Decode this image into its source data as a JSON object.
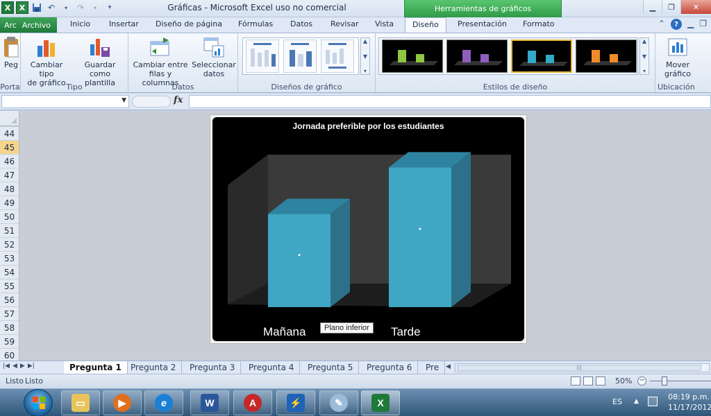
{
  "window": {
    "title": "Gráficas  -  Microsoft Excel uso no comercial",
    "contextual_tab": "Herramientas de gráficos",
    "app_icon_letter": "X"
  },
  "ribbon_tabs": {
    "file": "Archivo",
    "file_left_fragment": "Arc",
    "items": [
      "Inicio",
      "Insertar",
      "Diseño de página",
      "Fórmulas",
      "Datos",
      "Revisar",
      "Vista",
      "Diseño",
      "Presentación",
      "Formato"
    ],
    "active": "Diseño"
  },
  "ribbon": {
    "groups": {
      "portapapeles": "Porta",
      "tipo": "Tipo",
      "datos": "Datos",
      "disenos": "Diseños de gráfico",
      "estilos": "Estilos de diseño",
      "ubicacion": "Ubicación"
    },
    "buttons": {
      "pegar": "Peg",
      "cambiar_tipo_l1": "Cambiar tipo",
      "cambiar_tipo_l2": "de gráfico",
      "guardar_l1": "Guardar como",
      "guardar_l2": "plantilla",
      "cambiar_filas_l1": "Cambiar entre",
      "cambiar_filas_l2": "filas y columnas",
      "seleccionar_l1": "Seleccionar",
      "seleccionar_l2": "datos",
      "mover_l1": "Mover",
      "mover_l2": "gráfico"
    },
    "style_colors": [
      "#8dc63f",
      "#8e5fbf",
      "#31a9c7",
      "#f08a2a"
    ],
    "selected_style": 2
  },
  "formula_bar": {
    "name_box": "",
    "fx_label": "fx",
    "content": ""
  },
  "rows": {
    "numbers": [
      "44",
      "45",
      "46",
      "47",
      "48",
      "49",
      "50",
      "51",
      "52",
      "53",
      "54",
      "55",
      "56",
      "57",
      "58",
      "59",
      "60"
    ],
    "selected": "45"
  },
  "chart_data": {
    "type": "bar",
    "title": "Jornada preferible por los estudiantes",
    "categories": [
      "Mañana",
      "Tarde"
    ],
    "values": [
      0.64,
      0.96
    ],
    "ylim": [
      0,
      1
    ],
    "grid": false,
    "legend": "none",
    "bar_color": "#3fa6c4",
    "bar_top_color": "#2e84a0",
    "bar_side_color": "#2c7189",
    "tooltip": "Plano inferior"
  },
  "sheet_tabs": {
    "items": [
      "Pregunta 1",
      "Pregunta 2",
      "Pregunta 3",
      "Pregunta 4",
      "Pregunta 5",
      "Pregunta 6",
      "Pre"
    ],
    "active": "Pregunta 1"
  },
  "status": {
    "text": "Listo",
    "left_fragment": "Listo",
    "zoom": "50%"
  },
  "taskbar": {
    "apps": [
      "explorer",
      "media-player",
      "internet-explorer",
      "word",
      "autocad",
      "messenger",
      "paint",
      "excel"
    ],
    "language": "ES",
    "time": "08:19 p.m.",
    "date": "11/17/2012"
  }
}
